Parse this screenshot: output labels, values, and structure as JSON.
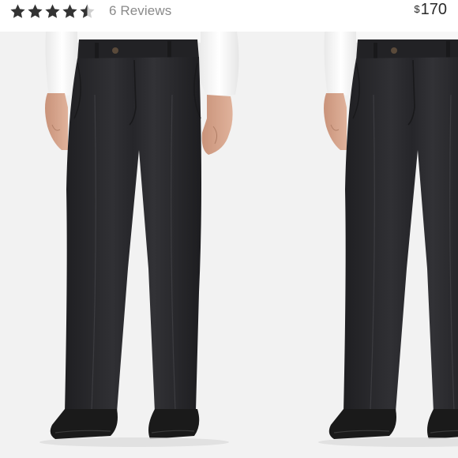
{
  "rating": {
    "value": 4.5,
    "max": 5,
    "star_color": "#333333",
    "star_empty_color": "#cfcfcf",
    "icon": "star-icon"
  },
  "reviews": {
    "label": "6 Reviews"
  },
  "price": {
    "currency": "$",
    "amount": "170"
  },
  "photo": {
    "subject": "dress-pants",
    "background_color": "#f2f2f2",
    "pants_color": "#2b2b2e",
    "shirt_color": "#ffffff",
    "shoe_color": "#1a1a1a"
  }
}
